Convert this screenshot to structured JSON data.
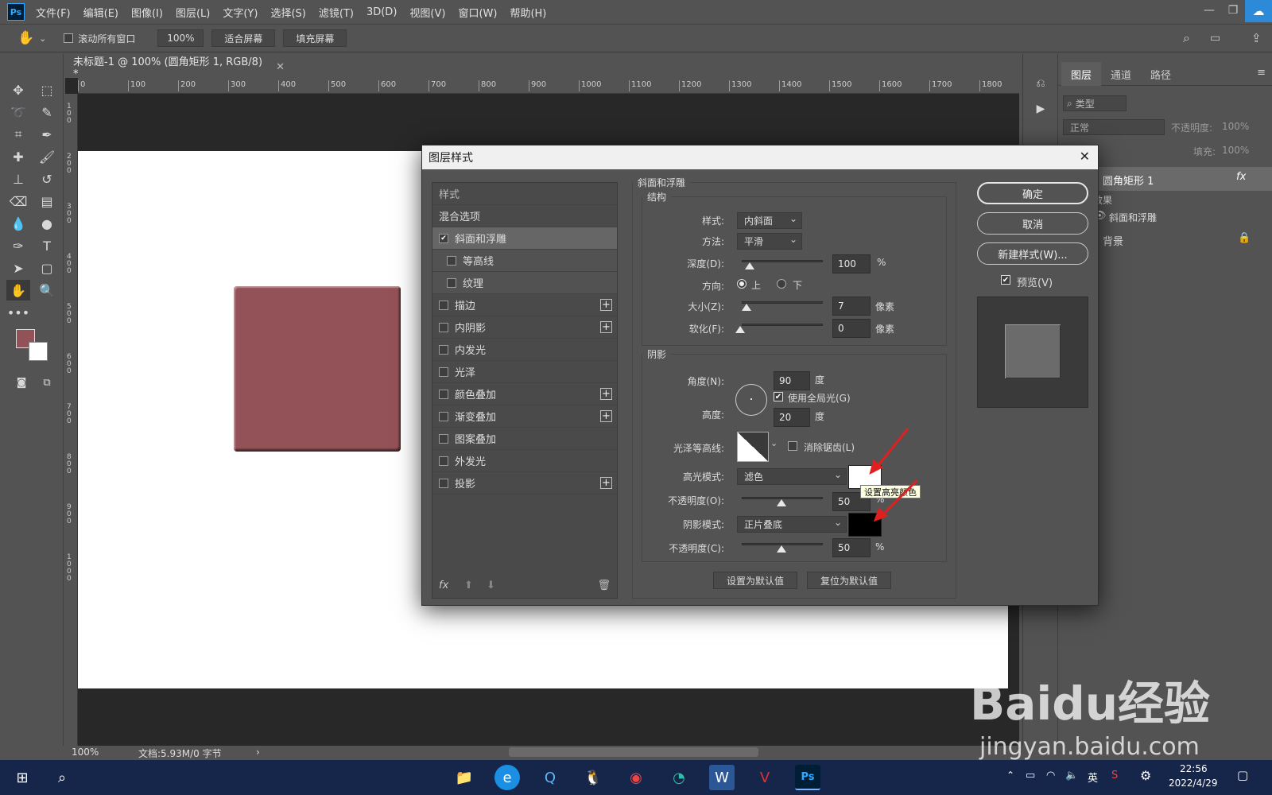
{
  "menubar": {
    "logo": "Ps",
    "items": [
      "文件(F)",
      "编辑(E)",
      "图像(I)",
      "图层(L)",
      "文字(Y)",
      "选择(S)",
      "滤镜(T)",
      "3D(D)",
      "视图(V)",
      "窗口(W)",
      "帮助(H)"
    ]
  },
  "options": {
    "scroll_all": "滚动所有窗口",
    "zoom": "100%",
    "fit_screen": "适合屏幕",
    "fill_screen": "填充屏幕"
  },
  "document": {
    "tab_title": "未标题-1 @ 100% (圆角矩形 1, RGB/8) *",
    "ruler_top": [
      "0",
      "100",
      "200",
      "300",
      "400",
      "500",
      "600",
      "700",
      "800",
      "900",
      "1000",
      "1100",
      "1200",
      "1300",
      "1400",
      "1500",
      "1600",
      "1700",
      "1800"
    ],
    "ruler_left": [
      "100",
      "200",
      "300",
      "400",
      "500",
      "600",
      "700",
      "800",
      "900",
      "1000"
    ],
    "shape_color": "#935257",
    "zoom_status": "100%",
    "doc_info": "文档:5.93M/0 字节"
  },
  "layers_panel": {
    "tabs": [
      "图层",
      "通道",
      "路径"
    ],
    "filter_placeholder": "类型",
    "blend_mode": "正常",
    "opacity_label": "不透明度:",
    "opacity_value": "100%",
    "fill_label": "填充:",
    "fill_value": "100%",
    "layers": [
      {
        "name": "圆角矩形 1",
        "fx": "fx"
      },
      {
        "name": "效果"
      },
      {
        "name": "斜面和浮雕"
      },
      {
        "name": "背景"
      }
    ]
  },
  "dialog": {
    "title": "图层样式",
    "close": "✕",
    "styles_header": "样式",
    "blend_options": "混合选项",
    "style_items": [
      {
        "label": "斜面和浮雕",
        "checked": true,
        "plus": false,
        "indent": false
      },
      {
        "label": "等高线",
        "checked": false,
        "plus": false,
        "indent": true
      },
      {
        "label": "纹理",
        "checked": false,
        "plus": false,
        "indent": true
      },
      {
        "label": "描边",
        "checked": false,
        "plus": true,
        "indent": false
      },
      {
        "label": "内阴影",
        "checked": false,
        "plus": true,
        "indent": false
      },
      {
        "label": "内发光",
        "checked": false,
        "plus": false,
        "indent": false
      },
      {
        "label": "光泽",
        "checked": false,
        "plus": false,
        "indent": false
      },
      {
        "label": "颜色叠加",
        "checked": false,
        "plus": true,
        "indent": false
      },
      {
        "label": "渐变叠加",
        "checked": false,
        "plus": true,
        "indent": false
      },
      {
        "label": "图案叠加",
        "checked": false,
        "plus": false,
        "indent": false
      },
      {
        "label": "外发光",
        "checked": false,
        "plus": false,
        "indent": false
      },
      {
        "label": "投影",
        "checked": false,
        "plus": true,
        "indent": false
      }
    ],
    "fx_label": "fx",
    "section_title": "斜面和浮雕",
    "structure": {
      "legend": "结构",
      "style_label": "样式:",
      "style_value": "内斜面",
      "technique_label": "方法:",
      "technique_value": "平滑",
      "depth_label": "深度(D):",
      "depth_value": "100",
      "depth_unit": "%",
      "direction_label": "方向:",
      "dir_up": "上",
      "dir_down": "下",
      "size_label": "大小(Z):",
      "size_value": "7",
      "size_unit": "像素",
      "soften_label": "软化(F):",
      "soften_value": "0",
      "soften_unit": "像素"
    },
    "shading": {
      "legend": "阴影",
      "angle_label": "角度(N):",
      "angle_value": "90",
      "angle_unit": "度",
      "global_light": "使用全局光(G)",
      "altitude_label": "高度:",
      "altitude_value": "20",
      "altitude_unit": "度",
      "gloss_label": "光泽等高线:",
      "anti_alias": "消除锯齿(L)",
      "highlight_label": "高光模式:",
      "highlight_value": "滤色",
      "highlight_opacity_label": "不透明度(O):",
      "highlight_opacity_value": "50",
      "highlight_unit": "%",
      "shadow_label": "阴影模式:",
      "shadow_value": "正片叠底",
      "shadow_opacity_label": "不透明度(C):",
      "shadow_opacity_value": "50",
      "shadow_unit": "%",
      "highlight_color": "#ffffff",
      "shadow_color": "#000000",
      "tooltip": "设置高亮颜色"
    },
    "make_default": "设置为默认值",
    "reset_default": "复位为默认值",
    "ok": "确定",
    "cancel": "取消",
    "new_style": "新建样式(W)...",
    "preview": "预览(V)"
  },
  "taskbar": {
    "tray_lang": "英",
    "time": "22:56",
    "date": "2022/4/29"
  },
  "watermark": {
    "brand": "Baidu经验",
    "url": "jingyan.baidu.com"
  }
}
